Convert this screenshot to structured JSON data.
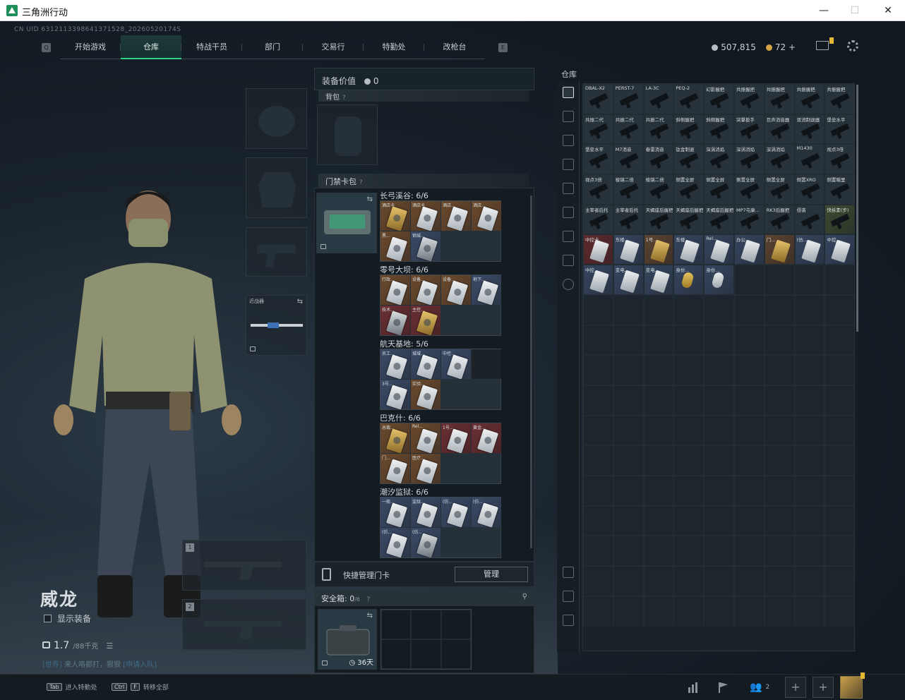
{
  "window": {
    "title": "三角洲行动",
    "min": "—",
    "max": "☐",
    "close": "✕"
  },
  "uid": "CN UID 6312113398641371528_20260520174S",
  "nav": {
    "left_key": "Q",
    "right_key": "E",
    "tabs": [
      {
        "label": "开始游戏",
        "active": false
      },
      {
        "label": "仓库",
        "active": true
      },
      {
        "label": "特战干员",
        "active": false
      },
      {
        "label": "部门",
        "active": false
      },
      {
        "label": "交易行",
        "active": false
      },
      {
        "label": "特勤处",
        "active": false,
        "badge": true
      },
      {
        "label": "改枪台",
        "active": false
      }
    ]
  },
  "currency": {
    "silver": "507,815",
    "gold": "72",
    "gold_add": "+"
  },
  "character": {
    "name": "威龙",
    "show_equipment": "显示装备",
    "weight_value": "1.7",
    "weight_max": "/88千克",
    "recruit_prefix": "[世界]",
    "recruit_text": "来人咯都打，狠狠",
    "recruit_link": "[申请入队]"
  },
  "equipment": {
    "melee_label": "近战器",
    "slot1": "1",
    "slot2": "2"
  },
  "middle": {
    "equip_value_label": "装备价值",
    "equip_value": "0",
    "backpack_label": "背包",
    "keycard_label": "门禁卡包",
    "help": "?",
    "maps": [
      {
        "name": "长弓溪谷: 6/6",
        "cards": [
          {
            "name": "酒店卡",
            "tone": "gold",
            "art": "gold"
          },
          {
            "name": "酒店卡",
            "tone": "gold",
            "art": "silver"
          },
          {
            "name": "酒店...",
            "tone": "gold",
            "art": "silver"
          },
          {
            "name": "酒店...",
            "tone": "gold",
            "art": "silver"
          },
          {
            "name": "黑...",
            "tone": "gold",
            "art": "silver"
          },
          {
            "name": "钢城...",
            "tone": "blue",
            "art": "dark"
          }
        ]
      },
      {
        "name": "零号大坝: 6/6",
        "cards": [
          {
            "name": "行政...",
            "tone": "gold",
            "art": "silver"
          },
          {
            "name": "设备...",
            "tone": "gold",
            "art": "silver"
          },
          {
            "name": "设备...",
            "tone": "gold",
            "art": "silver"
          },
          {
            "name": "地下...",
            "tone": "blue",
            "art": "silver"
          },
          {
            "name": "技术...",
            "tone": "red",
            "art": "dark"
          },
          {
            "name": "主控...",
            "tone": "red",
            "art": "gold"
          }
        ]
      },
      {
        "name": "航天基地: 5/6",
        "cards": [
          {
            "name": "员工...",
            "tone": "blue",
            "art": "silver"
          },
          {
            "name": "城域...",
            "tone": "blue",
            "art": "silver"
          },
          {
            "name": "中控...",
            "tone": "blue",
            "art": "silver"
          },
          {
            "name": "",
            "tone": "empty",
            "art": "none"
          },
          {
            "name": "3号...",
            "tone": "blue",
            "art": "silver"
          },
          {
            "name": "实验...",
            "tone": "gold",
            "art": "silver"
          }
        ]
      },
      {
        "name": "巴克什: 6/6",
        "cards": [
          {
            "name": "总裁...",
            "tone": "gold",
            "art": "gold"
          },
          {
            "name": "Rel...",
            "tone": "gold",
            "art": "silver"
          },
          {
            "name": "1号...",
            "tone": "red",
            "art": "silver"
          },
          {
            "name": "黄金...",
            "tone": "red",
            "art": "silver"
          },
          {
            "name": "门...",
            "tone": "gold",
            "art": "silver"
          },
          {
            "name": "医疗...",
            "tone": "gold",
            "art": "silver"
          }
        ]
      },
      {
        "name": "潮汐监狱: 6/6",
        "cards": [
          {
            "name": "一般...",
            "tone": "blue",
            "art": "silver"
          },
          {
            "name": "监狱...",
            "tone": "blue",
            "art": "silver"
          },
          {
            "name": "(仿...",
            "tone": "blue",
            "art": "silver"
          },
          {
            "name": "(仿...",
            "tone": "blue",
            "art": "silver"
          },
          {
            "name": "(仿...",
            "tone": "blue",
            "art": "silver"
          },
          {
            "name": "(仿...",
            "tone": "blue",
            "art": "dark"
          }
        ]
      }
    ],
    "quick_manage": "快捷管理门卡",
    "manage_btn": "管理",
    "safe_label": "安全箱:",
    "safe_count": "0",
    "safe_max": "/6",
    "safe_pin": "📌",
    "safe_days": "36天"
  },
  "warehouse": {
    "title": "仓库",
    "items": [
      {
        "name": "DBAL-X2",
        "kind": "part",
        "tone": "filled"
      },
      {
        "name": "PERST-7",
        "kind": "part",
        "tone": "filled"
      },
      {
        "name": "LA-3C",
        "kind": "part",
        "tone": "filled"
      },
      {
        "name": "PEQ-2",
        "kind": "part",
        "tone": "filled"
      },
      {
        "name": "幻影握把",
        "kind": "part",
        "tone": "filled"
      },
      {
        "name": "共振握把",
        "kind": "part",
        "tone": "filled"
      },
      {
        "name": "共振握把",
        "kind": "part",
        "tone": "filled"
      },
      {
        "name": "共振握把",
        "kind": "part",
        "tone": "filled"
      },
      {
        "name": "共振握把",
        "kind": "part",
        "tone": "filled"
      },
      {
        "name": "共振二代",
        "kind": "part",
        "tone": "filled"
      },
      {
        "name": "共振二代",
        "kind": "part",
        "tone": "filled"
      },
      {
        "name": "共振二代",
        "kind": "part",
        "tone": "filled"
      },
      {
        "name": "斜侧握把",
        "kind": "part",
        "tone": "filled"
      },
      {
        "name": "斜侧握把",
        "kind": "part",
        "tone": "filled"
      },
      {
        "name": "突撃扳手",
        "kind": "part",
        "tone": "filled"
      },
      {
        "name": "巨声消音器",
        "kind": "part",
        "tone": "filled"
      },
      {
        "name": "双流制退器",
        "kind": "part",
        "tone": "filled"
      },
      {
        "name": "堡垒水平",
        "kind": "part",
        "tone": "filled"
      },
      {
        "name": "堡垒水平",
        "kind": "part",
        "tone": "filled"
      },
      {
        "name": "M7消音",
        "kind": "part",
        "tone": "filled"
      },
      {
        "name": "春雷消音",
        "kind": "part",
        "tone": "filled"
      },
      {
        "name": "钛金制退",
        "kind": "part",
        "tone": "filled"
      },
      {
        "name": "深涡消焰",
        "kind": "part",
        "tone": "filled"
      },
      {
        "name": "深涡消焰",
        "kind": "part",
        "tone": "filled"
      },
      {
        "name": "深涡消焰",
        "kind": "part",
        "tone": "filled"
      },
      {
        "name": "M1430",
        "kind": "part",
        "tone": "filled"
      },
      {
        "name": "视点3倍",
        "kind": "part",
        "tone": "filled"
      },
      {
        "name": "视点3倍",
        "kind": "part",
        "tone": "filled"
      },
      {
        "name": "棱镜二倍",
        "kind": "part",
        "tone": "filled"
      },
      {
        "name": "棱镜二倍",
        "kind": "part",
        "tone": "filled"
      },
      {
        "name": "侧置全屏",
        "kind": "part",
        "tone": "filled"
      },
      {
        "name": "侧置全屏",
        "kind": "part",
        "tone": "filled"
      },
      {
        "name": "侧置全屏",
        "kind": "part",
        "tone": "filled"
      },
      {
        "name": "侧置全屏",
        "kind": "part",
        "tone": "filled"
      },
      {
        "name": "侧置XRO",
        "kind": "part",
        "tone": "filled"
      },
      {
        "name": "侧置瞄里",
        "kind": "part",
        "tone": "filled"
      },
      {
        "name": "主宰者后托",
        "kind": "part",
        "tone": "filled"
      },
      {
        "name": "主宰者后托",
        "kind": "part",
        "tone": "filled"
      },
      {
        "name": "天蝎座后握把",
        "kind": "part",
        "tone": "filled"
      },
      {
        "name": "天蝎座后握把",
        "kind": "part",
        "tone": "filled"
      },
      {
        "name": "天蝎座后握把",
        "kind": "part",
        "tone": "filled"
      },
      {
        "name": "MP7屯康...",
        "kind": "part",
        "tone": "filled"
      },
      {
        "name": "RK3后握把",
        "kind": "part",
        "tone": "filled"
      },
      {
        "name": "侵袭",
        "kind": "part",
        "tone": "filled"
      },
      {
        "name": "快拆素(步)",
        "kind": "part",
        "tone": "green"
      },
      {
        "name": "中控卡",
        "kind": "card",
        "tone": "red"
      },
      {
        "name": "东楼...",
        "kind": "card",
        "tone": "blue"
      },
      {
        "name": "1号...",
        "kind": "card",
        "tone": "gold"
      },
      {
        "name": "东楼...",
        "kind": "card",
        "tone": "blue"
      },
      {
        "name": "Rel...",
        "kind": "card",
        "tone": "blue"
      },
      {
        "name": "办公...",
        "kind": "card",
        "tone": "blue"
      },
      {
        "name": "门...",
        "kind": "card",
        "tone": "gold"
      },
      {
        "name": "(仿...",
        "kind": "card",
        "tone": "blue"
      },
      {
        "name": "中控...",
        "kind": "card",
        "tone": "blue"
      },
      {
        "name": "中控...",
        "kind": "card",
        "tone": "blue"
      },
      {
        "name": "变电...",
        "kind": "card",
        "tone": "blue"
      },
      {
        "name": "变电...",
        "kind": "card",
        "tone": "blue"
      },
      {
        "name": "身份...",
        "kind": "tag",
        "tone": "blue"
      },
      {
        "name": "身份...",
        "kind": "tag-silver",
        "tone": "blue"
      }
    ]
  },
  "bottom": {
    "tab_key": "Tab",
    "tab_hint": "进入特勤处",
    "ctrl_key": "Ctrl",
    "f_key": "F",
    "ctrl_hint": "转移全部",
    "team_count": "2",
    "add": "+"
  },
  "colors": {
    "accent": "#2fd08a",
    "badge": "#e5b833"
  }
}
